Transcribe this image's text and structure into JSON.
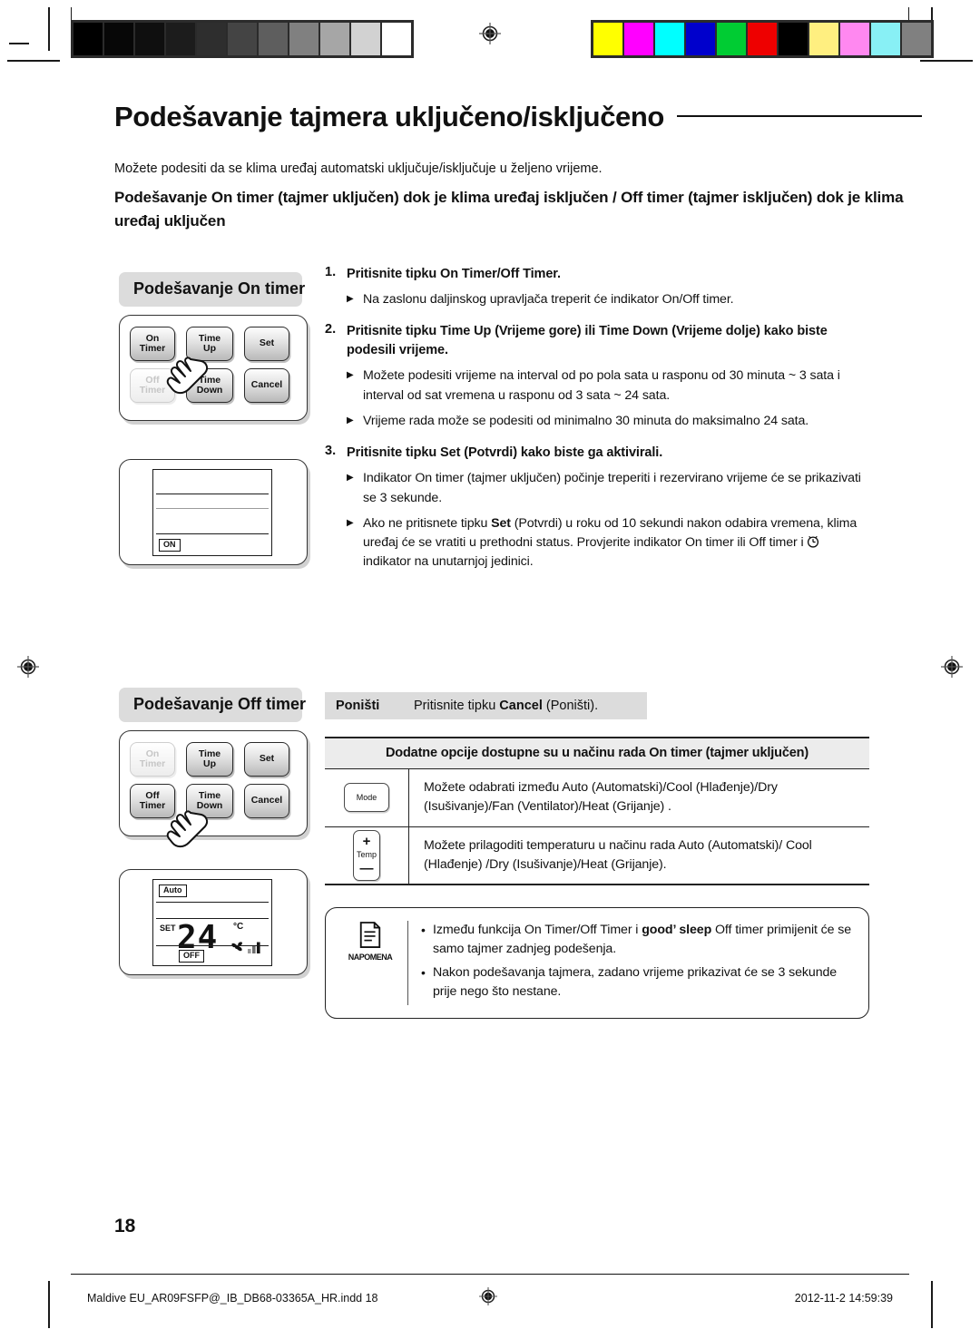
{
  "document": {
    "title": "Podešavanje tajmera uključeno/isključeno",
    "intro": "Možete podesiti da se klima uređaj automatski uključuje/isključuje u željeno vrijeme.",
    "subhead": "Podešavanje On timer (tajmer uključen) dok je klima uređaj isključen / Off timer (tajmer isključen) dok je klima uređaj uključen",
    "page_number": "18"
  },
  "sections": {
    "on_timer_label": "Podešavanje On timer",
    "off_timer_label": "Podešavanje Off timer"
  },
  "remote": {
    "buttons": {
      "on_timer": "On\nTimer",
      "on_timer_line1": "On",
      "on_timer_line2": "Timer",
      "time_up_line1": "Time",
      "time_up_line2": "Up",
      "set": "Set",
      "off_timer_line1": "Off",
      "off_timer_line2": "Timer",
      "time_down_line1": "Time",
      "time_down_line2": "Down",
      "cancel": "Cancel"
    },
    "hand_icon": "hand-pointing-icon"
  },
  "lcd_on": {
    "status_tag": "ON"
  },
  "lcd_off": {
    "mode_tag": "Auto",
    "set_label": "SET",
    "temperature": "24",
    "unit": "°C",
    "fan_icon": "fan-icon",
    "status_tag": "OFF"
  },
  "steps": [
    {
      "num": "1.",
      "text": "Pritisnite tipku On Timer/Off Timer.",
      "bullets": [
        "Na zaslonu daljinskog upravljača treperit će indikator On/Off timer."
      ]
    },
    {
      "num": "2.",
      "text": "Pritisnite tipku Time Up (Vrijeme gore) ili Time Down (Vrijeme dolje) kako biste podesili vrijeme.",
      "bullets": [
        "Možete podesiti vrijeme na interval od po pola sata u rasponu od 30 minuta ~ 3 sata i interval od sat vremena u rasponu od 3 sata ~ 24 sata.",
        "Vrijeme rada može se podesiti od minimalno 30 minuta do maksimalno 24 sata."
      ]
    },
    {
      "num": "3.",
      "text": "Pritisnite tipku Set (Potvrdi) kako biste ga aktivirali.",
      "bullets": [
        "Indikator On timer (tajmer uključen) počinje treperiti i rezervirano vrijeme će se prikazivati se 3 sekunde."
      ]
    }
  ],
  "step3_bullet2": {
    "pre": "Ako ne pritisnete tipku ",
    "bold": "Set",
    "mid": " (Potvrdi) u roku od 10 sekundi nakon odabira vremena, klima uređaj će se vratiti u prethodni status. Provjerite indikator On timer ili Off timer i ",
    "clock_icon": "clock-icon",
    "post": " indikator na unutarnjoj jedinici."
  },
  "cancel_row": {
    "key": "Poništi",
    "pre": "Pritisnite tipku ",
    "bold": "Cancel",
    "post": " (Poništi)."
  },
  "options_table": {
    "header": "Dodatne opcije dostupne su u načinu rada On timer (tajmer uključen)",
    "rows": [
      {
        "icon_label": "Mode",
        "icon_name": "mode-button-icon",
        "text": "Možete odabrati između Auto (Automatski)/Cool (Hlađenje)/Dry (Isušivanje)/Fan (Ventilator)/Heat (Grijanje) ."
      },
      {
        "icon_label": "Temp",
        "icon_plus": "+",
        "icon_minus": "—",
        "icon_name": "temp-button-icon",
        "text": "Možete prilagoditi temperaturu u načinu rada Auto (Automatski)/ Cool (Hlađenje) /Dry (Isušivanje)/Heat (Grijanje)."
      }
    ]
  },
  "note": {
    "icon_name": "note-document-icon",
    "label": "NAPOMENA",
    "items": [
      {
        "pre": "Između funkcija On Timer/Off Timer i ",
        "bold": "good’ sleep",
        "post": " Off timer primijenit će se samo tajmer zadnjeg podešenja."
      },
      {
        "pre": "",
        "bold": "",
        "post": "Nakon podešavanja tajmera, zadano vrijeme prikazivat će se 3 sekunde prije nego što nestane."
      }
    ]
  },
  "footer": {
    "file": "Maldive EU_AR09FSFP@_IB_DB68-03365A_HR.indd   18",
    "timestamp": "2012-11-2   14:59:39",
    "registration_icon": "registration-target-icon"
  },
  "calibration": {
    "grayscale": [
      "#000000",
      "#070707",
      "#0f0f0f",
      "#1c1c1c",
      "#2e2e2e",
      "#444444",
      "#5e5e5e",
      "#808080",
      "#a6a6a6",
      "#d2d2d2",
      "#ffffff"
    ],
    "colors": [
      "#ffff00",
      "#ff00ff",
      "#00ffff",
      "#0000cc",
      "#00cc33",
      "#ee0000",
      "#000000",
      "#ffef80",
      "#ff88f0",
      "#88f0f5",
      "#808080"
    ]
  }
}
